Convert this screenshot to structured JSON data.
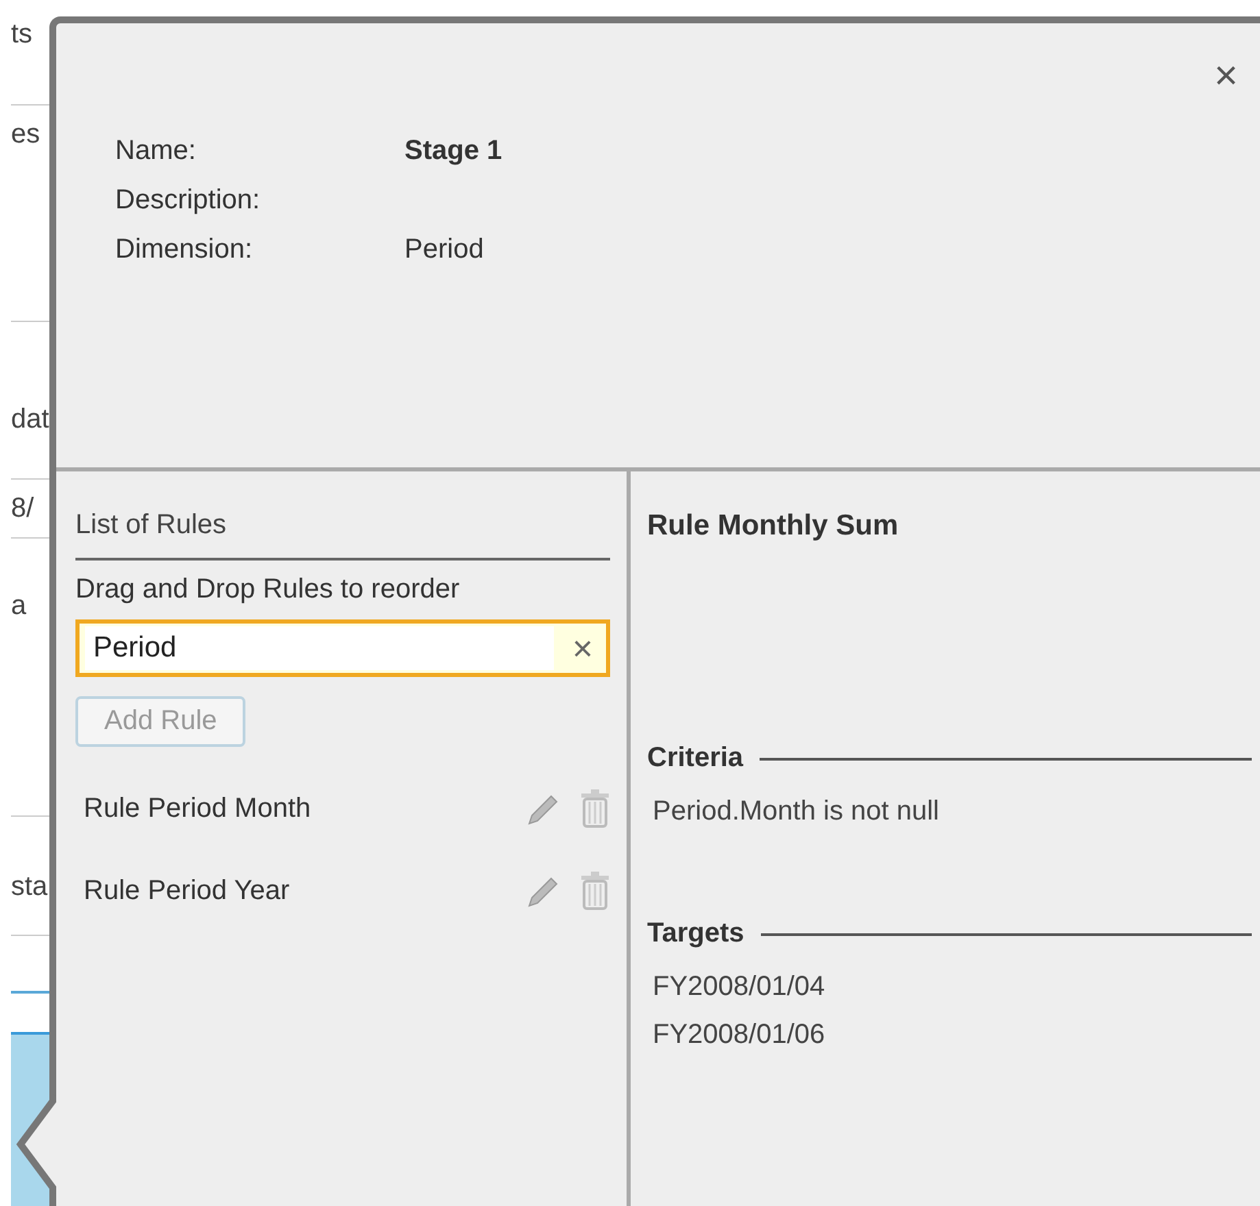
{
  "background_fragments": [
    "ts",
    "es",
    "dat",
    "8/",
    "a",
    "sta"
  ],
  "dialog": {
    "close": "×",
    "fields": [
      {
        "label": "Name:",
        "value": "Stage 1",
        "kind": "bold"
      },
      {
        "label": "Description:",
        "kind": "plain"
      },
      {
        "label": "Dimension:",
        "value": "Period",
        "kind": "plain"
      }
    ]
  },
  "rules_panel": {
    "title": "List of Rules",
    "hint": "Drag and Drop Rules to reorder",
    "filter": {
      "value": "Period",
      "clear": "×",
      "focused": true
    },
    "add_button": {
      "label": "Add Rule",
      "disabled": true
    },
    "rules": [
      {
        "name": "Rule Period Month"
      },
      {
        "name": "Rule Period Year"
      }
    ]
  },
  "detail": {
    "title": "Rule Monthly Sum",
    "sections": [
      {
        "heading": "Criteria",
        "items": [
          "Period.Month is not null"
        ]
      },
      {
        "heading": "Targets",
        "items": [
          "FY2008/01/04",
          "FY2008/01/06"
        ]
      }
    ]
  }
}
